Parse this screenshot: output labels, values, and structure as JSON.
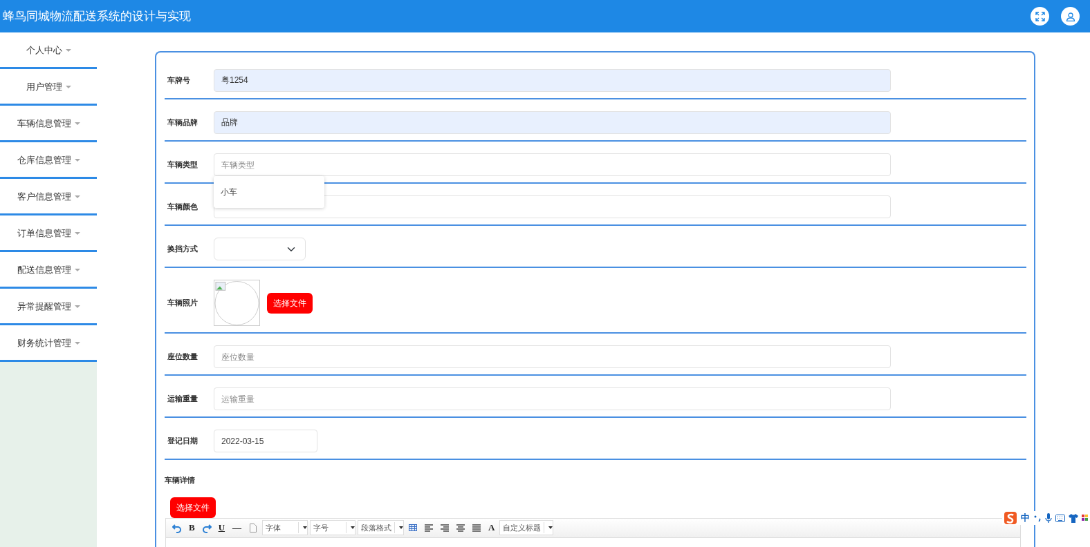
{
  "header": {
    "title": "蜂鸟同城物流配送系统的设计与实现"
  },
  "sidebar": {
    "items": [
      {
        "label": "个人中心"
      },
      {
        "label": "用户管理"
      },
      {
        "label": "车辆信息管理"
      },
      {
        "label": "仓库信息管理"
      },
      {
        "label": "客户信息管理"
      },
      {
        "label": "订单信息管理"
      },
      {
        "label": "配送信息管理"
      },
      {
        "label": "异常提醒管理"
      },
      {
        "label": "财务统计管理"
      }
    ]
  },
  "form": {
    "fields": [
      {
        "kind": "text",
        "label": "车牌号",
        "value": "粤1254",
        "readonly": true
      },
      {
        "kind": "text",
        "label": "车辆品牌",
        "value": "品牌",
        "readonly": true
      },
      {
        "kind": "text",
        "label": "车辆类型",
        "placeholder": "车辆类型",
        "readonly": false,
        "suggestions": [
          "小车"
        ]
      },
      {
        "kind": "text",
        "label": "车辆颜色",
        "readonly": false
      },
      {
        "kind": "select",
        "label": "换挡方式"
      },
      {
        "kind": "image",
        "label": "车辆照片",
        "button": "选择文件"
      },
      {
        "kind": "text",
        "label": "座位数量",
        "placeholder": "座位数量",
        "readonly": false
      },
      {
        "kind": "text",
        "label": "运输重量",
        "placeholder": "运输重量",
        "readonly": false
      },
      {
        "kind": "date",
        "label": "登记日期",
        "value": "2022-03-15"
      },
      {
        "kind": "editor",
        "label": "车辆详情",
        "button": "选择文件",
        "toolbar": [
          {
            "kind": "undo"
          },
          {
            "kind": "char",
            "text": "B"
          },
          {
            "kind": "redo"
          },
          {
            "kind": "char",
            "text": "U"
          },
          {
            "kind": "char",
            "text": "—"
          },
          {
            "kind": "page"
          },
          {
            "kind": "select",
            "text": "字体"
          },
          {
            "kind": "select",
            "text": "字号"
          },
          {
            "kind": "select",
            "text": "段落格式"
          },
          {
            "kind": "table"
          },
          {
            "kind": "alignleft"
          },
          {
            "kind": "alignright"
          },
          {
            "kind": "aligncenter"
          },
          {
            "kind": "justify"
          },
          {
            "kind": "char",
            "text": "A"
          },
          {
            "kind": "select",
            "text": "自定义标题"
          }
        ]
      }
    ]
  },
  "ime": {
    "mode": "中"
  }
}
